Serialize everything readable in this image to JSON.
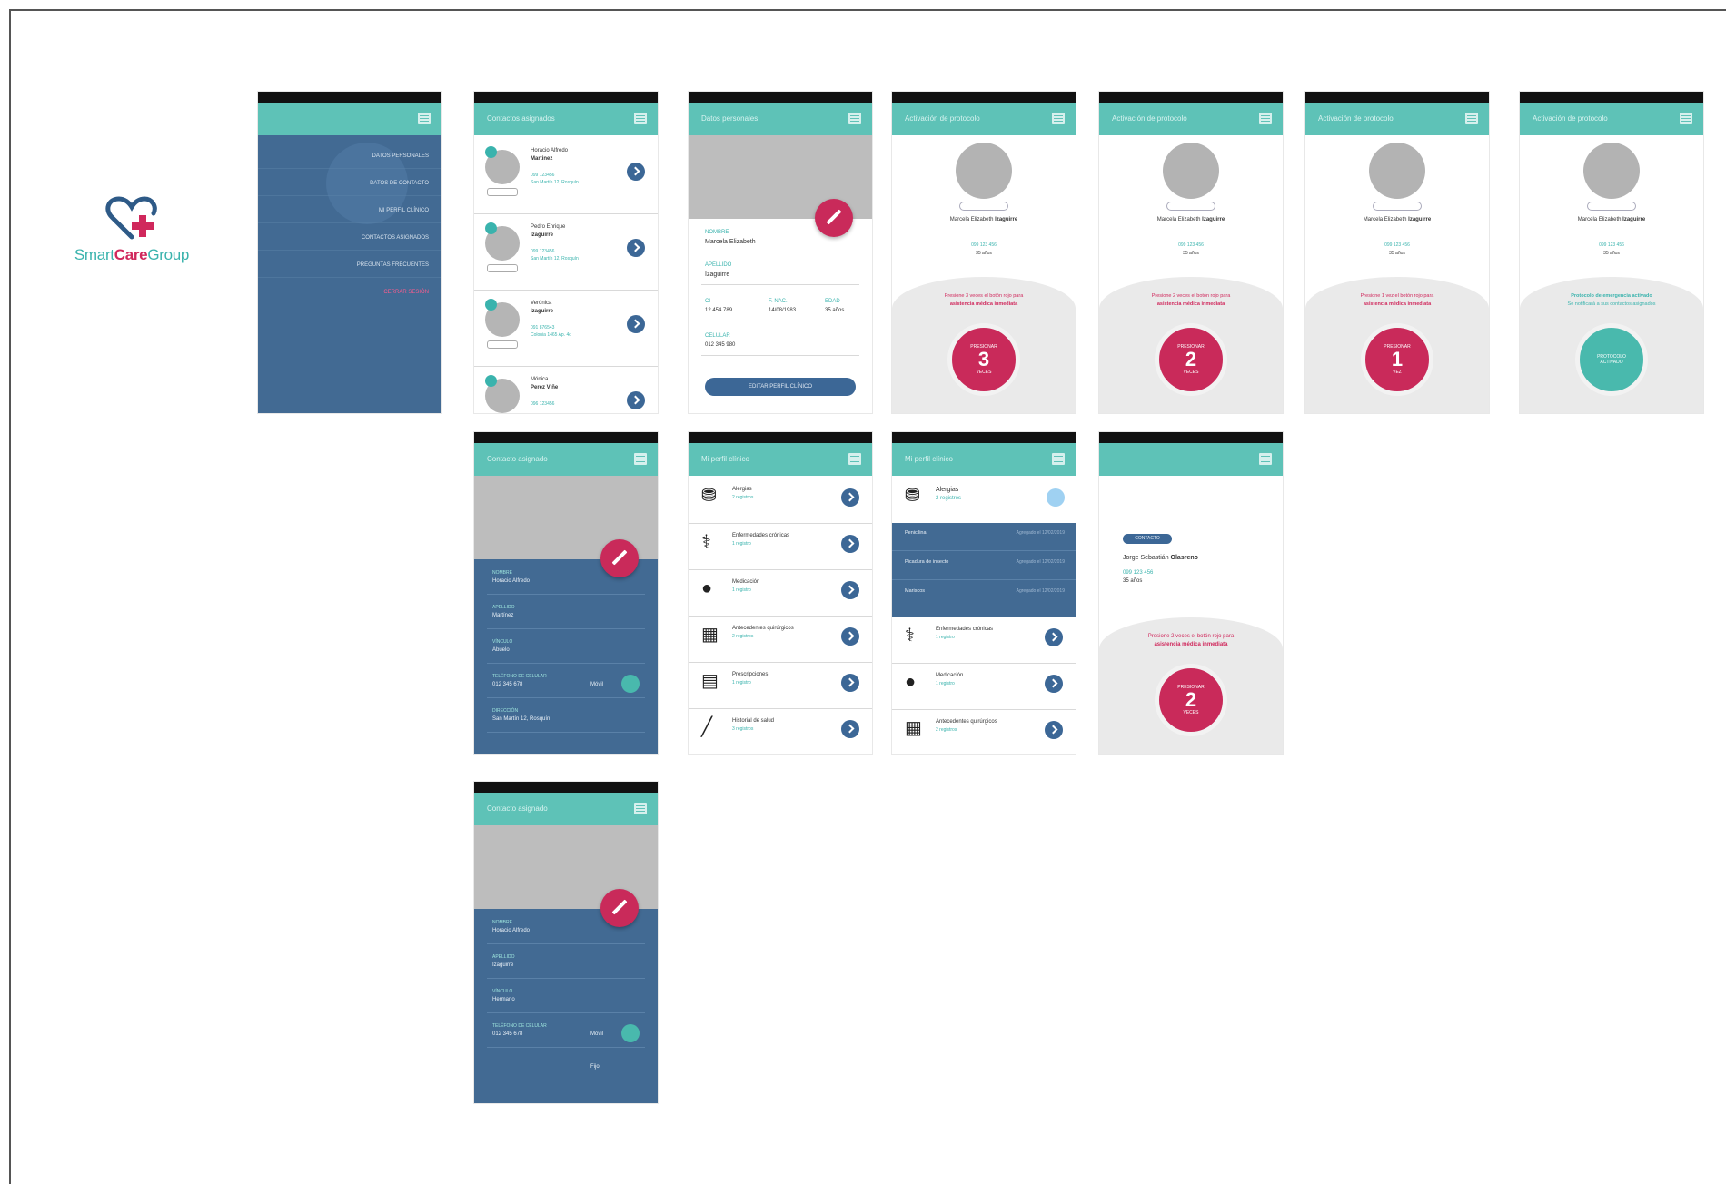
{
  "logo": {
    "part1": "Smart",
    "part2": "Care",
    "part3": "Group"
  },
  "colors": {
    "teal": "#5ec2b7",
    "blue": "#426a93",
    "magenta": "#c92a5a",
    "dark": "#111111"
  },
  "icons": [
    "heart-cross-icon",
    "menu-icon",
    "edit-pencil-icon",
    "chevron-right-icon",
    "inhaler-icon",
    "stethoscope-icon",
    "pill-icon",
    "calendar-icon",
    "calculator-icon",
    "syringe-icon"
  ],
  "menu_screen": {
    "items": [
      "DATOS PERSONALES",
      "DATOS DE CONTACTO",
      "MI PERFIL CLÍNICO",
      "CONTACTOS ASIGNADOS",
      "PREGUNTAS FRECUENTES",
      "CERRAR SESIÓN"
    ]
  },
  "contacts_screen": {
    "title": "Contactos asignados",
    "contacts": [
      {
        "first": "Horacio Alfredo",
        "last": "Martinez",
        "phone": "099 123456",
        "address": "San Martín 12, Rosquín"
      },
      {
        "first": "Pedro Enrique",
        "last": "Izaguirre",
        "phone": "099 123456",
        "address": "San Martín 12, Rosquín"
      },
      {
        "first": "Verónica",
        "last": "Izaguirre",
        "phone": "091 876543",
        "address": "Colonia 1465 Ap. 4c"
      },
      {
        "first": "Mónica",
        "last": "Perez Viñe",
        "phone": "096 123456",
        "address": ""
      }
    ]
  },
  "personal_screen": {
    "title": "Datos personales",
    "fields": [
      {
        "label": "NOMBRE",
        "value": "Marcela Elizabeth"
      },
      {
        "label": "APELLIDO",
        "value": "Izaguirre"
      },
      {
        "label": "CI",
        "value": "12.454.789"
      },
      {
        "label": "F. NAC.",
        "value": "14/08/1983"
      },
      {
        "label": "EDAD",
        "value": "35 años"
      },
      {
        "label": "CELULAR",
        "value": "012 345 980"
      }
    ],
    "button": "EDITAR PERFIL CLÍNICO"
  },
  "protocol_screens": [
    {
      "title": "Activación de protocolo",
      "name_first": "Marcela Elizabeth",
      "name_last": "Izaguirre",
      "phone": "099 123 456",
      "age": "35 años",
      "message": "Presione 3 veces el botón rojo para",
      "message2": "asistencia médica inmediata",
      "btn_top": "PRESIONAR",
      "btn_num": "3",
      "btn_bottom": "VECES",
      "variant": "red"
    },
    {
      "title": "Activación de protocolo",
      "name_first": "Marcela Elizabeth",
      "name_last": "Izaguirre",
      "phone": "099 123 456",
      "age": "35 años",
      "message": "Presione 2 veces el botón rojo para",
      "message2": "asistencia médica inmediata",
      "btn_top": "PRESIONAR",
      "btn_num": "2",
      "btn_bottom": "VECES",
      "variant": "red"
    },
    {
      "title": "Activación de protocolo",
      "name_first": "Marcela Elizabeth",
      "name_last": "Izaguirre",
      "phone": "099 123 456",
      "age": "35 años",
      "message": "Presione 1 vez el botón rojo para",
      "message2": "asistencia médica inmediata",
      "btn_top": "PRESIONAR",
      "btn_num": "1",
      "btn_bottom": "VEZ",
      "variant": "red"
    },
    {
      "title": "Activación de protocolo",
      "name_first": "Marcela Elizabeth",
      "name_last": "Izaguirre",
      "phone": "099 123 456",
      "age": "35 años",
      "message": "Protocolo de emergencia activado",
      "message2": "Se notificará a sus contactos asignados",
      "btn_top": "PROTOCOLO",
      "btn_num": "",
      "btn_bottom": "ACTIVADO",
      "variant": "teal"
    }
  ],
  "contact_detail_1": {
    "title": "Contacto asignado",
    "fields": [
      {
        "label": "NOMBRE",
        "value": "Horacio Alfredo"
      },
      {
        "label": "APELLIDO",
        "value": "Martínez"
      },
      {
        "label": "VÍNCULO",
        "value": "Abuelo"
      },
      {
        "label": "TELÉFONO DE CELULAR",
        "value": "012 345 678",
        "extra": "Móvil"
      },
      {
        "label": "DIRECCIÓN",
        "value": "San Martín 12, Rosquín"
      }
    ]
  },
  "contact_detail_2": {
    "title": "Contacto asignado",
    "fields": [
      {
        "label": "NOMBRE",
        "value": "Horacio Alfredo"
      },
      {
        "label": "APELLIDO",
        "value": "Izaguirre"
      },
      {
        "label": "VÍNCULO",
        "value": "Hermano"
      },
      {
        "label": "TELÉFONO DE CELULAR",
        "value": "012 345 678",
        "extra": "Móvil"
      }
    ],
    "extra_line": "Fijo"
  },
  "clinical_screen": {
    "title": "Mi perfil clínico",
    "items": [
      {
        "label": "Alergias",
        "sub": "2 registros"
      },
      {
        "label": "Enfermedades crónicas",
        "sub": "1 registro"
      },
      {
        "label": "Medicación",
        "sub": "1 registro"
      },
      {
        "label": "Antecedentes quirúrgicos",
        "sub": "2 registros"
      },
      {
        "label": "Prescripciones",
        "sub": "1 registro"
      },
      {
        "label": "Historial de salud",
        "sub": "3 registros"
      }
    ]
  },
  "clinical_expanded": {
    "title": "Mi perfil clínico",
    "top": {
      "label": "Alergias",
      "sub": "2 registros"
    },
    "sub_rows": [
      {
        "label": "Penicilina",
        "date": "Agregado el 12/02/2019"
      },
      {
        "label": "Picadura de insecto",
        "date": "Agregado el 12/02/2019"
      },
      {
        "label": "Mariscos",
        "date": "Agregado el 12/02/2019"
      }
    ],
    "items": [
      {
        "label": "Enfermedades crónicas",
        "sub": "1 registro"
      },
      {
        "label": "Medicación",
        "sub": "1 registro"
      },
      {
        "label": "Antecedentes quirúrgicos",
        "sub": "2 registros"
      }
    ]
  },
  "alert_screen": {
    "tag": "CONTACTO",
    "name_first": "Jorge Sebastián",
    "name_last": "Olasreno",
    "phone": "099 123 456",
    "age": "35 años",
    "message": "Presione 2 veces el botón rojo para",
    "message2": "asistencia médica inmediata",
    "btn_top": "PRESIONAR",
    "btn_num": "2",
    "btn_bottom": "VECES"
  }
}
